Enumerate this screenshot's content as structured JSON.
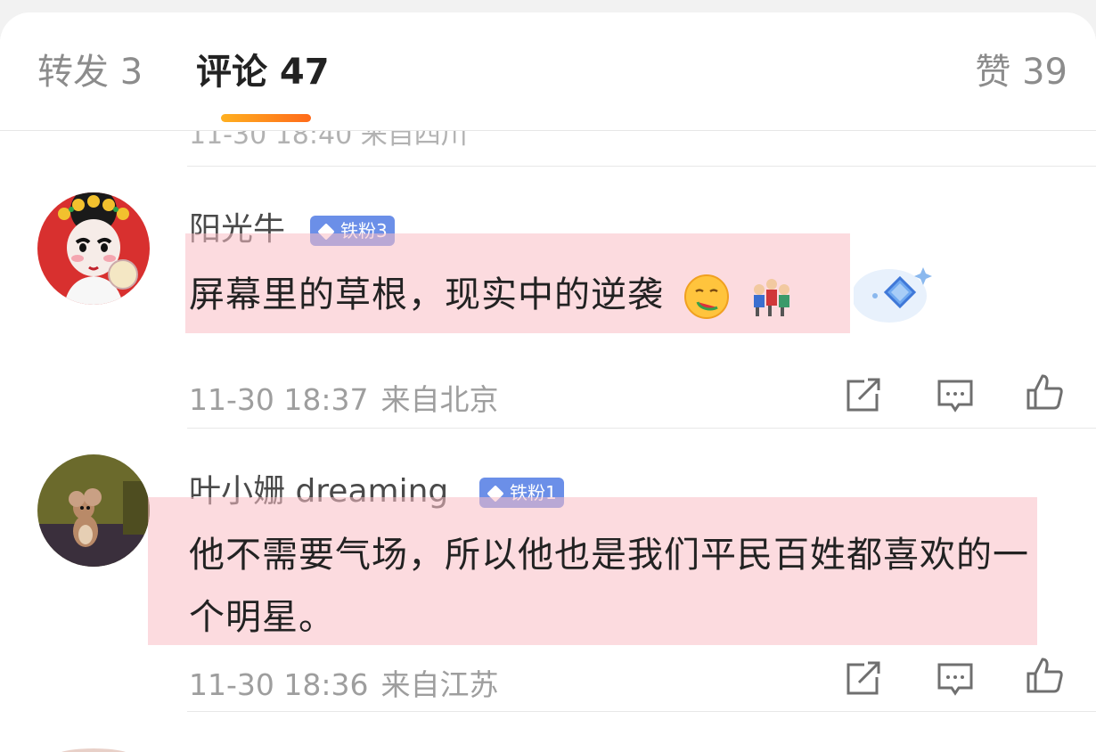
{
  "tabs": {
    "repost": "转发 3",
    "comments": "评论 47",
    "likes": "赞 39"
  },
  "previous_comment": {
    "meta": "11-30 18:40 来自四川"
  },
  "comments": [
    {
      "username": "阳光牛",
      "badge": "铁粉3",
      "text": "屏幕里的草根，现实中的逆袭",
      "time": "11-30 18:37",
      "location": "来自北京"
    },
    {
      "username": "叶小姗 dreaming",
      "badge": "铁粉1",
      "text": "他不需要气场，所以他也是我们平民百姓都喜欢的一个明星。",
      "time": "11-30 18:36",
      "location": "来自江苏"
    }
  ],
  "icons": {
    "share": "share-icon",
    "reply": "comment-icon",
    "like": "thumbs-up-icon"
  },
  "colors": {
    "accent": "#ff8a1a",
    "badge": "#6b8fe8",
    "highlight": "#fabec4"
  }
}
